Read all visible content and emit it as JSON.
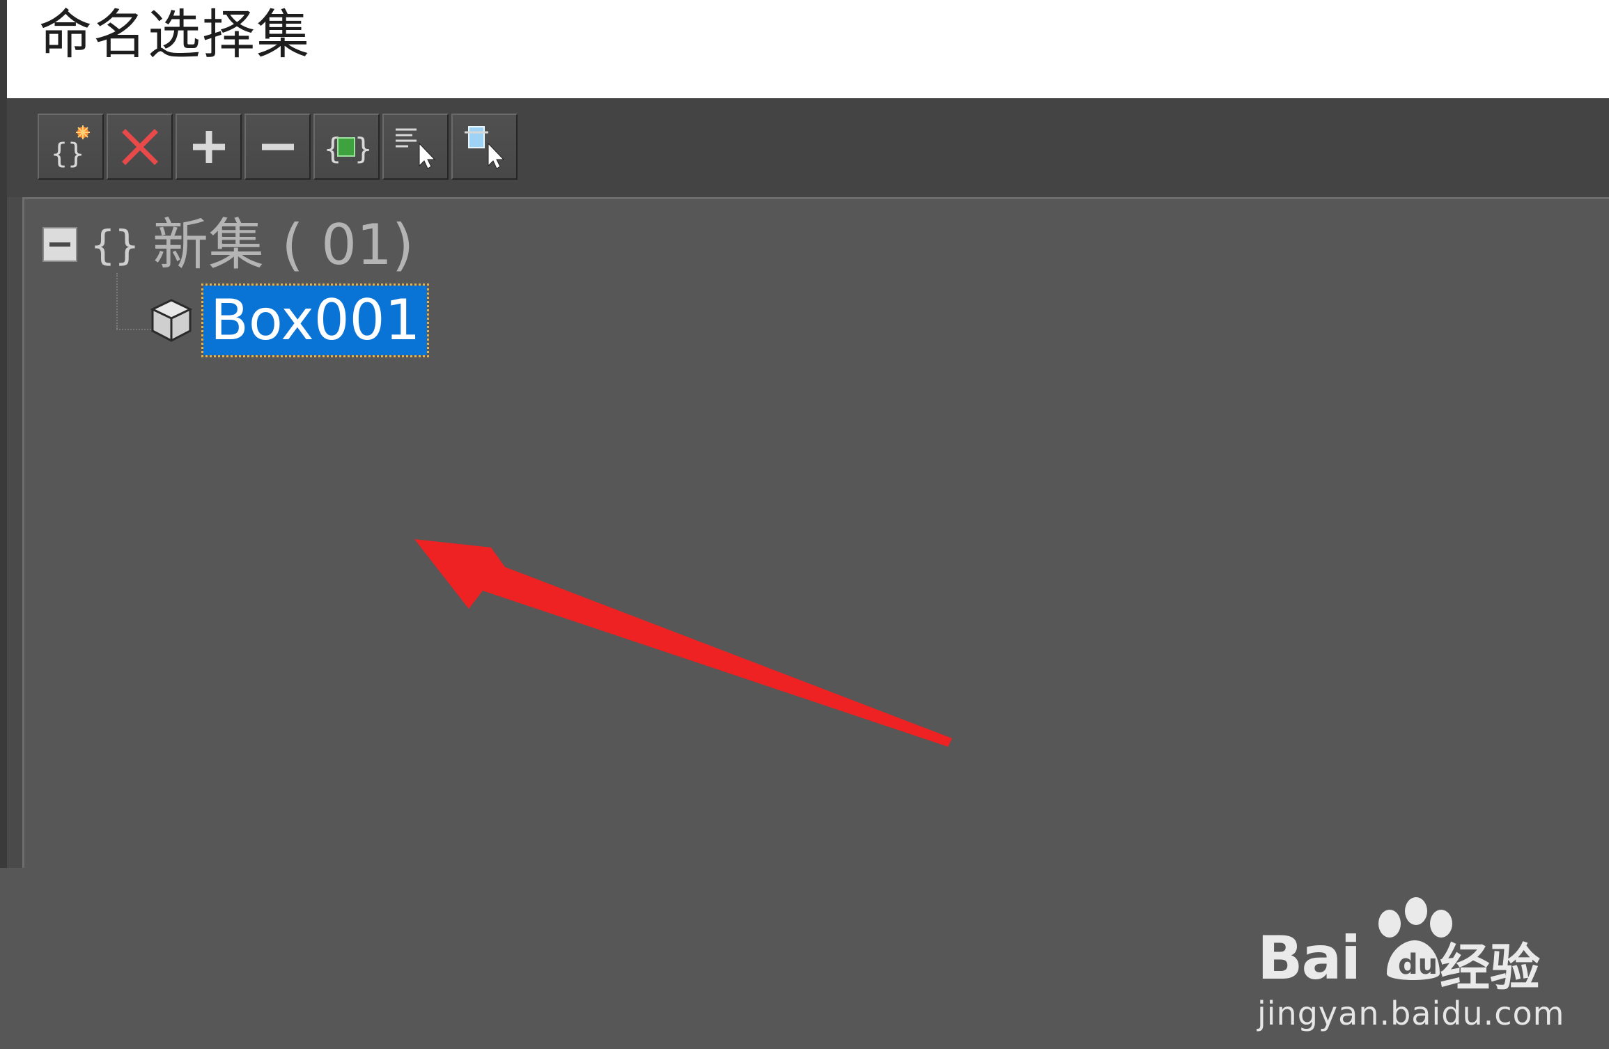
{
  "window": {
    "title": "命名选择集"
  },
  "toolbar": {
    "buttons": [
      {
        "icon": "create-set-icon"
      },
      {
        "icon": "delete-icon"
      },
      {
        "icon": "add-icon"
      },
      {
        "icon": "subtract-icon"
      },
      {
        "icon": "select-objects-in-set-icon"
      },
      {
        "icon": "select-by-name-icon"
      },
      {
        "icon": "highlight-selected-icon"
      }
    ]
  },
  "tree": {
    "set": {
      "label": "新集 ( 01)",
      "expanded": true
    },
    "objects": [
      {
        "label": "Box001",
        "selected": true
      }
    ]
  },
  "watermark": {
    "brand_prefix": "Bai",
    "brand_suffix": "经验",
    "url": "jingyan.baidu.com"
  },
  "colors": {
    "selection": "#0a74d6",
    "annotation_arrow": "#ee2222",
    "panel": "#575757",
    "toolbar": "#444444"
  }
}
